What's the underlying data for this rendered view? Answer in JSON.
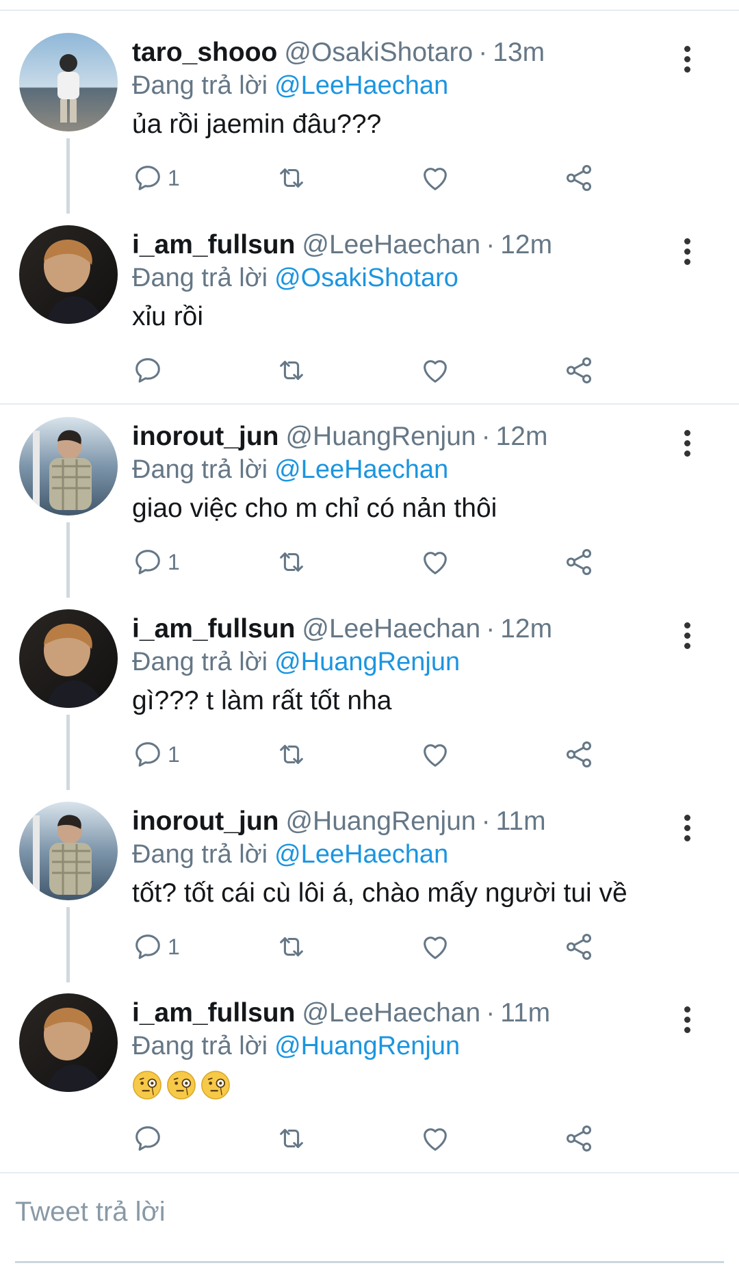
{
  "tweets": [
    {
      "name": "taro_shooo",
      "handle": "@OsakiShotaro",
      "sep": "·",
      "time": "13m",
      "replying_label": "Đang trả lời",
      "mention": "@LeeHaechan",
      "text": "ủa rồi jaemin đâu???",
      "reply_count": "1"
    },
    {
      "name": "i_am_fullsun",
      "handle": "@LeeHaechan",
      "sep": "·",
      "time": "12m",
      "replying_label": "Đang trả lời",
      "mention": "@OsakiShotaro",
      "text": "xỉu rồi",
      "reply_count": ""
    },
    {
      "name": "inorout_jun",
      "handle": "@HuangRenjun",
      "sep": "·",
      "time": "12m",
      "replying_label": "Đang trả lời",
      "mention": "@LeeHaechan",
      "text": "giao việc cho m chỉ có nản thôi",
      "reply_count": "1"
    },
    {
      "name": "i_am_fullsun",
      "handle": "@LeeHaechan",
      "sep": "·",
      "time": "12m",
      "replying_label": "Đang trả lời",
      "mention": "@HuangRenjun",
      "text": "gì??? t làm rất tốt nha",
      "reply_count": "1"
    },
    {
      "name": "inorout_jun",
      "handle": "@HuangRenjun",
      "sep": "·",
      "time": "11m",
      "replying_label": "Đang trả lời",
      "mention": "@LeeHaechan",
      "text": "tốt? tốt cái cù lôi á, chào mấy người tui về",
      "reply_count": "1"
    },
    {
      "name": "i_am_fullsun",
      "handle": "@LeeHaechan",
      "sep": "·",
      "time": "11m",
      "replying_label": "Đang trả lời",
      "mention": "@HuangRenjun",
      "text": "",
      "emojis": [
        "face-with-monocle",
        "face-with-monocle",
        "face-with-monocle"
      ],
      "reply_count": ""
    }
  ],
  "compose": {
    "placeholder": "Tweet trả lời"
  },
  "colors": {
    "link": "#1b95e0",
    "secondary_text": "#657786",
    "divider": "#e6ecf0",
    "thread_line": "#cfd9de"
  },
  "icons": {
    "reply": "reply-icon",
    "retweet": "retweet-icon",
    "like": "heart-icon",
    "share": "share-icon",
    "more": "more-vertical-icon"
  }
}
